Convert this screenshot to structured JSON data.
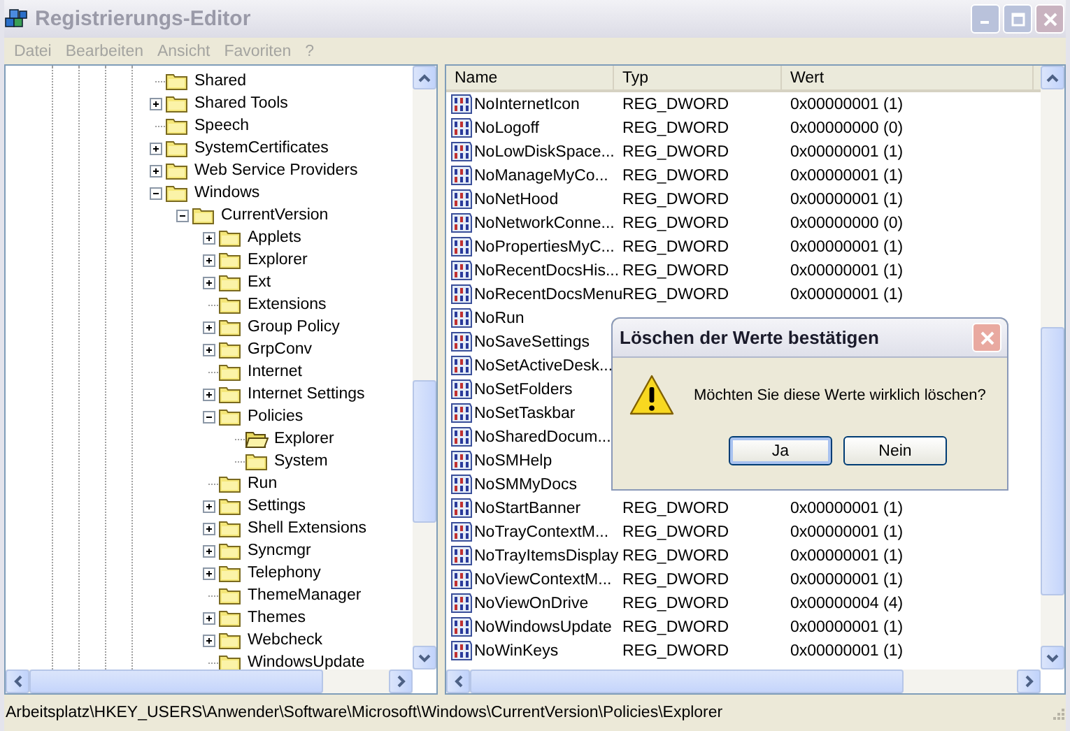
{
  "window": {
    "title": "Registrierungs-Editor"
  },
  "menu": [
    "Datei",
    "Bearbeiten",
    "Ansicht",
    "Favoriten",
    "?"
  ],
  "tree": [
    {
      "label": "Shared",
      "kind": "leaf",
      "selected": false
    },
    {
      "label": "Shared Tools",
      "kind": "branch",
      "expanded": false,
      "selected": false
    },
    {
      "label": "Speech",
      "kind": "leaf",
      "selected": false
    },
    {
      "label": "SystemCertificates",
      "kind": "branch",
      "expanded": false,
      "selected": false
    },
    {
      "label": "Web Service Providers",
      "kind": "branch",
      "expanded": false,
      "selected": false
    },
    {
      "label": "Windows",
      "kind": "branch",
      "expanded": true,
      "selected": false,
      "children": [
        {
          "label": "CurrentVersion",
          "kind": "branch",
          "expanded": true,
          "selected": false,
          "children": [
            {
              "label": "Applets",
              "kind": "branch",
              "expanded": false,
              "selected": false
            },
            {
              "label": "Explorer",
              "kind": "branch",
              "expanded": false,
              "selected": false
            },
            {
              "label": "Ext",
              "kind": "branch",
              "expanded": false,
              "selected": false
            },
            {
              "label": "Extensions",
              "kind": "leaf",
              "selected": false
            },
            {
              "label": "Group Policy",
              "kind": "branch",
              "expanded": false,
              "selected": false
            },
            {
              "label": "GrpConv",
              "kind": "branch",
              "expanded": false,
              "selected": false
            },
            {
              "label": "Internet",
              "kind": "leaf",
              "selected": false
            },
            {
              "label": "Internet Settings",
              "kind": "branch",
              "expanded": false,
              "selected": false
            },
            {
              "label": "Policies",
              "kind": "branch",
              "expanded": true,
              "selected": false,
              "children": [
                {
                  "label": "Explorer",
                  "kind": "leaf",
                  "selected": true
                },
                {
                  "label": "System",
                  "kind": "leaf",
                  "selected": false
                }
              ]
            },
            {
              "label": "Run",
              "kind": "leaf",
              "selected": false
            },
            {
              "label": "Settings",
              "kind": "branch",
              "expanded": false,
              "selected": false
            },
            {
              "label": "Shell Extensions",
              "kind": "branch",
              "expanded": false,
              "selected": false
            },
            {
              "label": "Syncmgr",
              "kind": "branch",
              "expanded": false,
              "selected": false
            },
            {
              "label": "Telephony",
              "kind": "branch",
              "expanded": false,
              "selected": false
            },
            {
              "label": "ThemeManager",
              "kind": "leaf",
              "selected": false
            },
            {
              "label": "Themes",
              "kind": "branch",
              "expanded": false,
              "selected": false
            },
            {
              "label": "Webcheck",
              "kind": "branch",
              "expanded": false,
              "selected": false
            },
            {
              "label": "WindowsUpdate",
              "kind": "leaf",
              "selected": false
            }
          ]
        }
      ]
    }
  ],
  "list": {
    "columns": [
      "Name",
      "Typ",
      "Wert"
    ],
    "rows": [
      {
        "name": "NoInternetIcon",
        "type": "REG_DWORD",
        "value": "0x00000001 (1)"
      },
      {
        "name": "NoLogoff",
        "type": "REG_DWORD",
        "value": "0x00000000 (0)"
      },
      {
        "name": "NoLowDiskSpace...",
        "type": "REG_DWORD",
        "value": "0x00000001 (1)"
      },
      {
        "name": "NoManageMyCo...",
        "type": "REG_DWORD",
        "value": "0x00000001 (1)"
      },
      {
        "name": "NoNetHood",
        "type": "REG_DWORD",
        "value": "0x00000001 (1)"
      },
      {
        "name": "NoNetworkConne...",
        "type": "REG_DWORD",
        "value": "0x00000000 (0)"
      },
      {
        "name": "NoPropertiesMyC...",
        "type": "REG_DWORD",
        "value": "0x00000001 (1)"
      },
      {
        "name": "NoRecentDocsHis...",
        "type": "REG_DWORD",
        "value": "0x00000001 (1)"
      },
      {
        "name": "NoRecentDocsMenu",
        "type": "REG_DWORD",
        "value": "0x00000001 (1)"
      },
      {
        "name": "NoRun"
      },
      {
        "name": "NoSaveSettings"
      },
      {
        "name": "NoSetActiveDesk..."
      },
      {
        "name": "NoSetFolders"
      },
      {
        "name": "NoSetTaskbar"
      },
      {
        "name": "NoSharedDocum..."
      },
      {
        "name": "NoSMHelp"
      },
      {
        "name": "NoSMMyDocs"
      },
      {
        "name": "NoStartBanner",
        "type": "REG_DWORD",
        "value": "0x00000001 (1)"
      },
      {
        "name": "NoTrayContextM...",
        "type": "REG_DWORD",
        "value": "0x00000001 (1)"
      },
      {
        "name": "NoTrayItemsDisplay",
        "type": "REG_DWORD",
        "value": "0x00000001 (1)"
      },
      {
        "name": "NoViewContextM...",
        "type": "REG_DWORD",
        "value": "0x00000001 (1)"
      },
      {
        "name": "NoViewOnDrive",
        "type": "REG_DWORD",
        "value": "0x00000004 (4)"
      },
      {
        "name": "NoWindowsUpdate",
        "type": "REG_DWORD",
        "value": "0x00000001 (1)"
      },
      {
        "name": "NoWinKeys",
        "type": "REG_DWORD",
        "value": "0x00000001 (1)"
      }
    ]
  },
  "dialog": {
    "title": "Löschen der Werte bestätigen",
    "message": "Möchten Sie diese Werte wirklich löschen?",
    "buttons": [
      {
        "label": "Ja",
        "default": true
      },
      {
        "label": "Nein",
        "default": false
      }
    ]
  },
  "status_bar": "Arbeitsplatz\\HKEY_USERS\\Anwender\\Software\\Microsoft\\Windows\\CurrentVersion\\Policies\\Explorer"
}
